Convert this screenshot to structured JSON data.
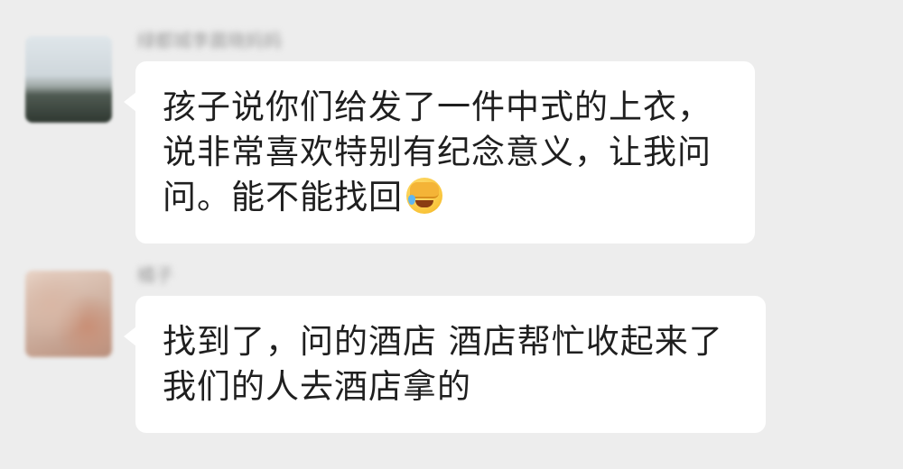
{
  "messages": [
    {
      "sender_name": "绿都城李晨晓妈妈",
      "lines": [
        "孩子说你们给发了一件中式的上衣，",
        "说非常喜欢特别有纪念意义，让我问",
        "问。能不能找回"
      ],
      "trailing_emoji": "facepalm-crying-emoji"
    },
    {
      "sender_name": "橘子",
      "lines": [
        "找到了，问的酒店 酒店帮忙收起来了",
        "我们的人去酒店拿的"
      ]
    }
  ],
  "colors": {
    "background": "#ededed",
    "bubble": "#ffffff",
    "text": "#1f1f1f",
    "sender_name": "#9a9a9a"
  }
}
